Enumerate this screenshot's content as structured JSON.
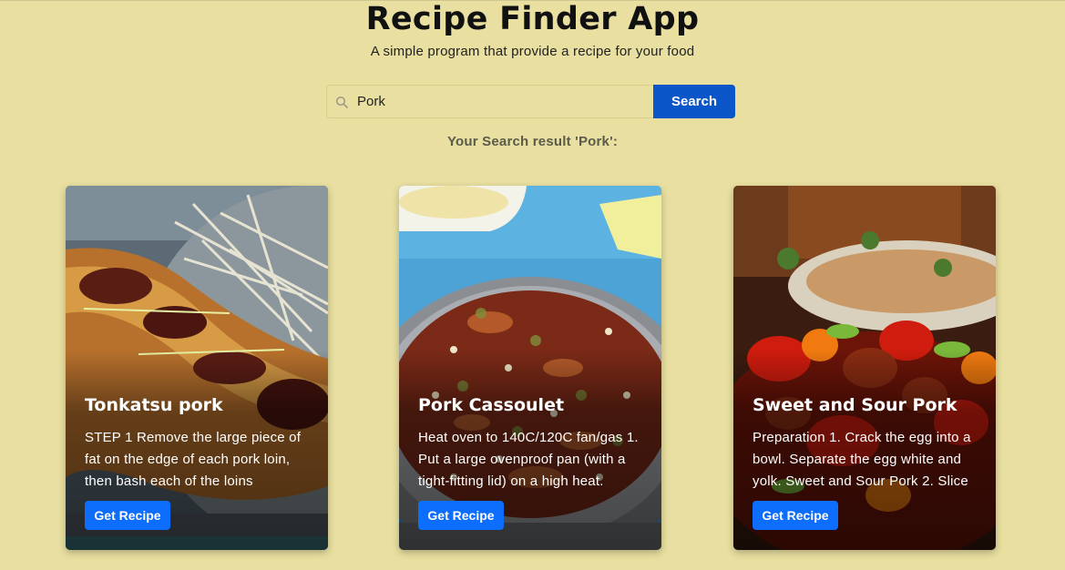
{
  "header": {
    "title": "Recipe Finder App",
    "subtitle": "A simple program that provide a recipe for your food"
  },
  "search": {
    "value": "Pork",
    "placeholder": "",
    "button_label": "Search",
    "icon": "search-icon"
  },
  "results": {
    "label": "Your Search result 'Pork':"
  },
  "cards": [
    {
      "title": "Tonkatsu pork",
      "text": "STEP 1 Remove the large piece of fat on the edge of each pork loin, then bash each of the loins",
      "button_label": "Get Recipe"
    },
    {
      "title": "Pork Cassoulet",
      "text": "Heat oven to 140C/120C fan/gas 1. Put a large ovenproof pan (with a tight-fitting lid) on a high heat.",
      "button_label": "Get Recipe"
    },
    {
      "title": "Sweet and Sour Pork",
      "text": "Preparation 1. Crack the egg into a bowl. Separate the egg white and yolk. Sweet and Sour Pork 2. Slice",
      "button_label": "Get Recipe"
    }
  ],
  "colors": {
    "background": "#e8dfa0",
    "search_button": "#0a55c7",
    "recipe_button": "#0d6efd"
  }
}
